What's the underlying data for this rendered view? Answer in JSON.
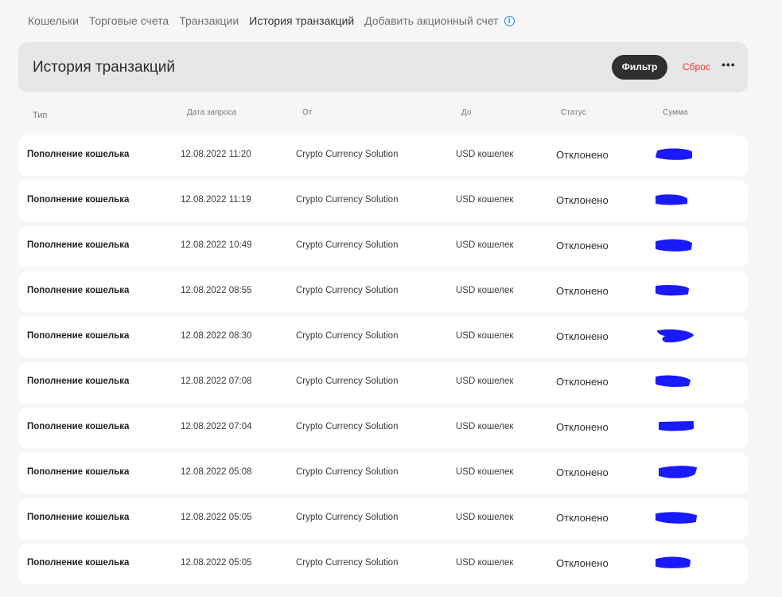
{
  "nav": {
    "tabs": [
      "Кошельки",
      "Торговые счета",
      "Транзакции",
      "История транзакций",
      "Добавить акционный счет"
    ],
    "active": 3,
    "info_icon": "info-icon"
  },
  "header": {
    "title": "История транзакций",
    "filter_label": "Фильтр",
    "reset_label": "Сброс",
    "more_label": "•••"
  },
  "columns": [
    "Тип",
    "Дата запроса",
    "От",
    "До",
    "Статус",
    "Сумма"
  ],
  "rows": [
    {
      "type": "Пополнение кошелька",
      "date": "12.08.2022 11:20",
      "from": "Crypto Currency Solution",
      "to": "USD кошелек",
      "status": "Отклонено"
    },
    {
      "type": "Пополнение кошелька",
      "date": "12.08.2022 11:19",
      "from": "Crypto Currency Solution",
      "to": "USD кошелек",
      "status": "Отклонено"
    },
    {
      "type": "Пополнение кошелька",
      "date": "12.08.2022 10:49",
      "from": "Crypto Currency Solution",
      "to": "USD кошелек",
      "status": "Отклонено"
    },
    {
      "type": "Пополнение кошелька",
      "date": "12.08.2022 08:55",
      "from": "Crypto Currency Solution",
      "to": "USD кошелек",
      "status": "Отклонено"
    },
    {
      "type": "Пополнение кошелька",
      "date": "12.08.2022 08:30",
      "from": "Crypto Currency Solution",
      "to": "USD кошелек",
      "status": "Отклонено"
    },
    {
      "type": "Пополнение кошелька",
      "date": "12.08.2022 07:08",
      "from": "Crypto Currency Solution",
      "to": "USD кошелек",
      "status": "Отклонено"
    },
    {
      "type": "Пополнение кошелька",
      "date": "12.08.2022 07:04",
      "from": "Crypto Currency Solution",
      "to": "USD кошелек",
      "status": "Отклонено"
    },
    {
      "type": "Пополнение кошелька",
      "date": "12.08.2022 05:08",
      "from": "Crypto Currency Solution",
      "to": "USD кошелек",
      "status": "Отклонено"
    },
    {
      "type": "Пополнение кошелька",
      "date": "12.08.2022 05:05",
      "from": "Crypto Currency Solution",
      "to": "USD кошелек",
      "status": "Отклонено"
    },
    {
      "type": "Пополнение кошелька",
      "date": "12.08.2022 05:05",
      "from": "Crypto Currency Solution",
      "to": "USD кошелек",
      "status": "Отклонено"
    }
  ],
  "colors": {
    "redaction": "#1a1aff",
    "reset": "#e53935",
    "filter_bg": "#2f2f2f",
    "info": "#1e88e5"
  }
}
